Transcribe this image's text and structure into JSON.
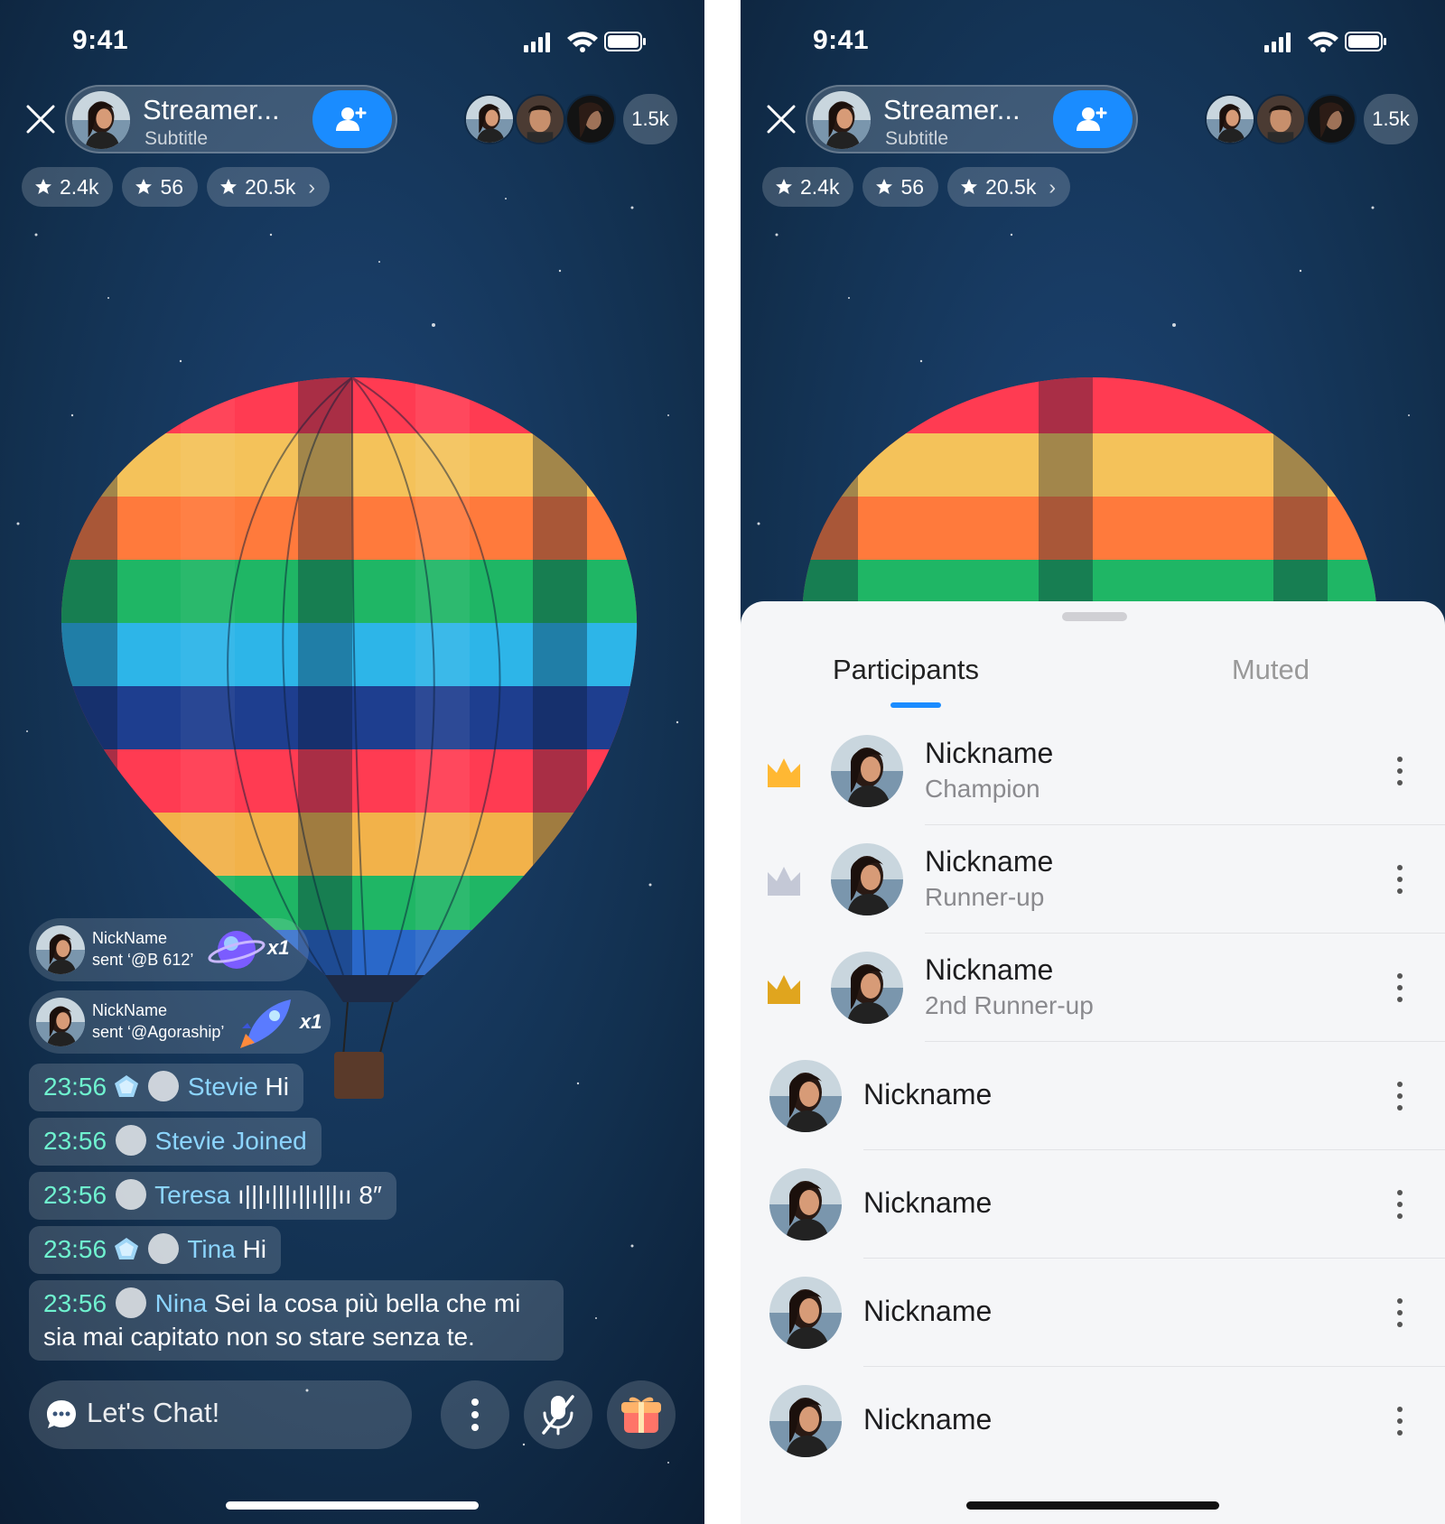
{
  "status": {
    "time": "9:41"
  },
  "streamer": {
    "name": "Streamer...",
    "subtitle": "Subtitle"
  },
  "viewers": {
    "count": "1.5k"
  },
  "stats": [
    {
      "value": "2.4k",
      "icon": "star-icon"
    },
    {
      "value": "56",
      "icon": "star-icon"
    },
    {
      "value": "20.5k",
      "icon": "star-icon",
      "chevron": "›"
    }
  ],
  "gifts": [
    {
      "nickname": "NickName",
      "sent": "sent ‘@B 612’",
      "multiplier": "x1",
      "gift_icon": "planet-icon"
    },
    {
      "nickname": "NickName",
      "sent": "sent ‘@Agoraship’",
      "multiplier": "x1",
      "gift_icon": "rocket-icon"
    }
  ],
  "chat": [
    {
      "time": "23:56",
      "name": "Stevie",
      "text": "Hi",
      "badge": "gem"
    },
    {
      "time": "23:56",
      "name": "Stevie Joined",
      "text": "",
      "badge": "none"
    },
    {
      "time": "23:56",
      "name": "Teresa",
      "text": "ı|||ı|||ı||ı|||ıı 8″",
      "badge": "none"
    },
    {
      "time": "23:56",
      "name": "Tina",
      "text": "Hi",
      "badge": "gem"
    },
    {
      "time": "23:56",
      "name": "Nina",
      "text": "Sei la cosa più bella che mi sia mai capitato non so stare senza te.",
      "badge": "none"
    }
  ],
  "chat_input": {
    "placeholder": "Let's Chat!"
  },
  "sheet": {
    "tabs": [
      "Participants",
      "Muted"
    ],
    "participants": [
      {
        "name": "Nickname",
        "rank": "Champion",
        "crown": "gold"
      },
      {
        "name": "Nickname",
        "rank": "Runner-up",
        "crown": "silver"
      },
      {
        "name": "Nickname",
        "rank": "2nd Runner-up",
        "crown": "bronze"
      },
      {
        "name": "Nickname",
        "rank": "",
        "crown": "none"
      },
      {
        "name": "Nickname",
        "rank": "",
        "crown": "none"
      },
      {
        "name": "Nickname",
        "rank": "",
        "crown": "none"
      },
      {
        "name": "Nickname",
        "rank": "",
        "crown": "none"
      }
    ]
  },
  "colors": {
    "accent": "#1a8cff",
    "chat_time": "#6ff2cf",
    "chat_name": "#8cd5ff",
    "crown_gold": "#ffb833",
    "crown_silver": "#c4c8d6",
    "crown_bronze": "#e0a51e"
  }
}
